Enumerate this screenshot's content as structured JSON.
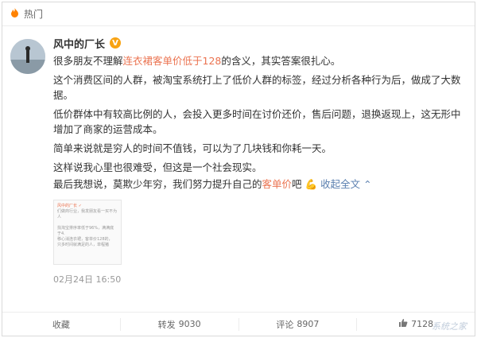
{
  "hotbar": {
    "label": "热门",
    "icon": "fire-icon"
  },
  "post": {
    "author": "风中的厂长",
    "verified_badge": "V",
    "paragraphs": [
      {
        "segments": [
          {
            "t": "很多朋友不理解"
          },
          {
            "t": "连衣裙客单价低于128",
            "hl": true
          },
          {
            "t": "的含义，其实答案很扎心。"
          }
        ]
      },
      {
        "segments": [
          {
            "t": "这个消费区间的人群，被淘宝系统打上了低价人群的标签，经过分析各种行为后，做成了大数据。"
          }
        ]
      },
      {
        "segments": [
          {
            "t": "低价群体中有较高比例的人，会投入更多时间在讨价还价，售后问题，退换返现上，这无形中增加了商家的运营成本。"
          }
        ]
      },
      {
        "segments": [
          {
            "t": "简单来说就是穷人的时间不值钱，可以为了几块钱和你耗一天。"
          }
        ]
      },
      {
        "segments": [
          {
            "t": "这样说我心里也很难受，但这是一个社会现实。"
          }
        ]
      }
    ],
    "last_line_before": "最后我想说，莫欺少年穷，我们努力提升自己的",
    "last_line_link": "客单价",
    "last_line_after": "吧",
    "emoji": "💪",
    "collapse_label": "收起全文",
    "thumbnail_lines": [
      "风中的厂长 ✓",
      "们做商行业，我发朋友看一买不为人",
      "",
      "找淘宝排序率低于96%，满满底于4.",
      "移心消连衣裙，客单价128的，",
      "只多时间就满足的人，单程猪"
    ],
    "timestamp": "02月24日 16:50"
  },
  "actions": {
    "favorite_label": "收藏",
    "repost_label": "转发",
    "repost_count": "9030",
    "comment_label": "评论",
    "comment_count": "8907",
    "like_icon": "thumbs-up-icon",
    "like_count": "7128"
  },
  "watermark": "系统之家"
}
